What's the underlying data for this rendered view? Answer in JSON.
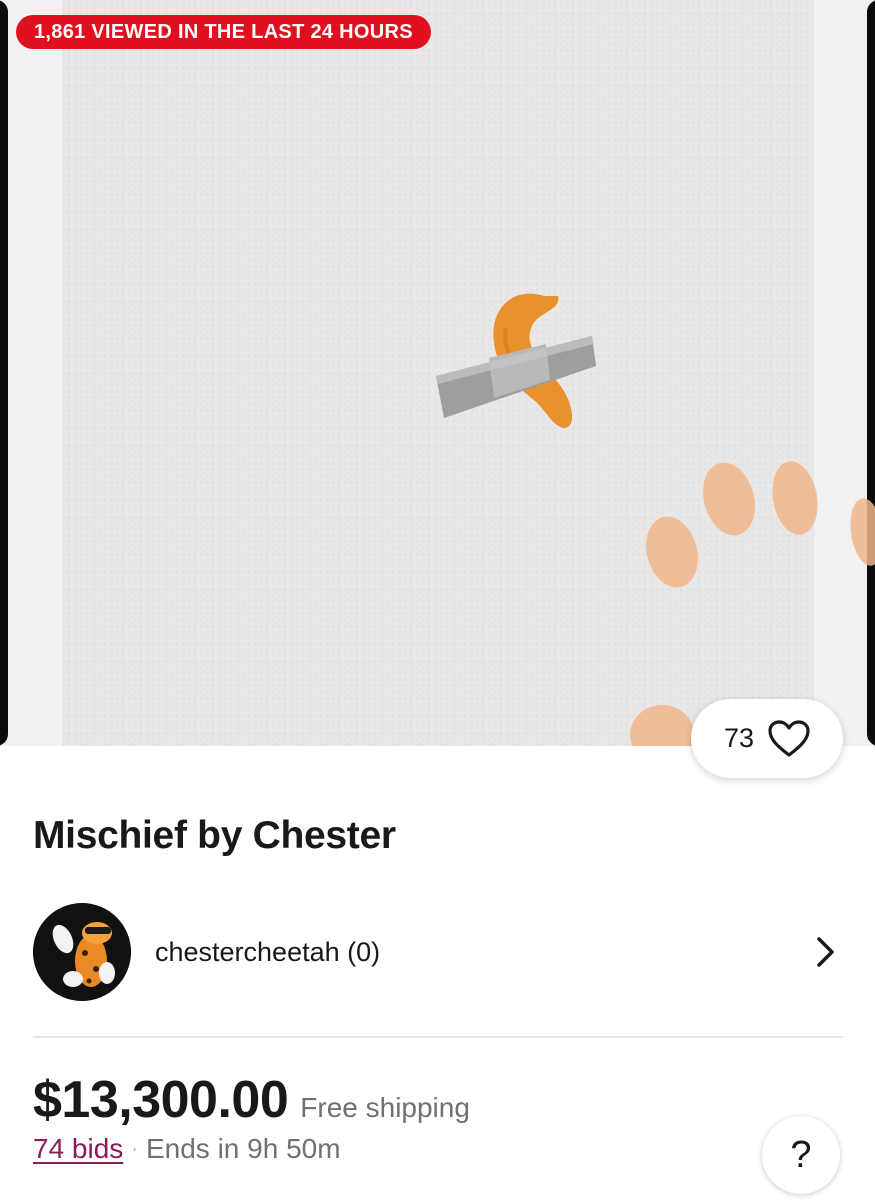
{
  "listing": {
    "views_badge": "1,861 VIEWED IN THE LAST 24 HOURS",
    "watch_count": "73",
    "title": "Mischief by Chester"
  },
  "seller": {
    "name": "chestercheetah (0)",
    "avatar_icon": "cheetah-avatar-icon",
    "nav_icon": "chevron-right-icon"
  },
  "pricing": {
    "price": "$13,300.00",
    "shipping": "Free shipping",
    "bids": "74 bids",
    "separator": "·",
    "time_left": "Ends in 9h 50m"
  },
  "help": {
    "label": "?"
  },
  "colors": {
    "badge_red": "#e0101e",
    "bids_link": "#8a1c5c",
    "muted_text": "#707070"
  }
}
